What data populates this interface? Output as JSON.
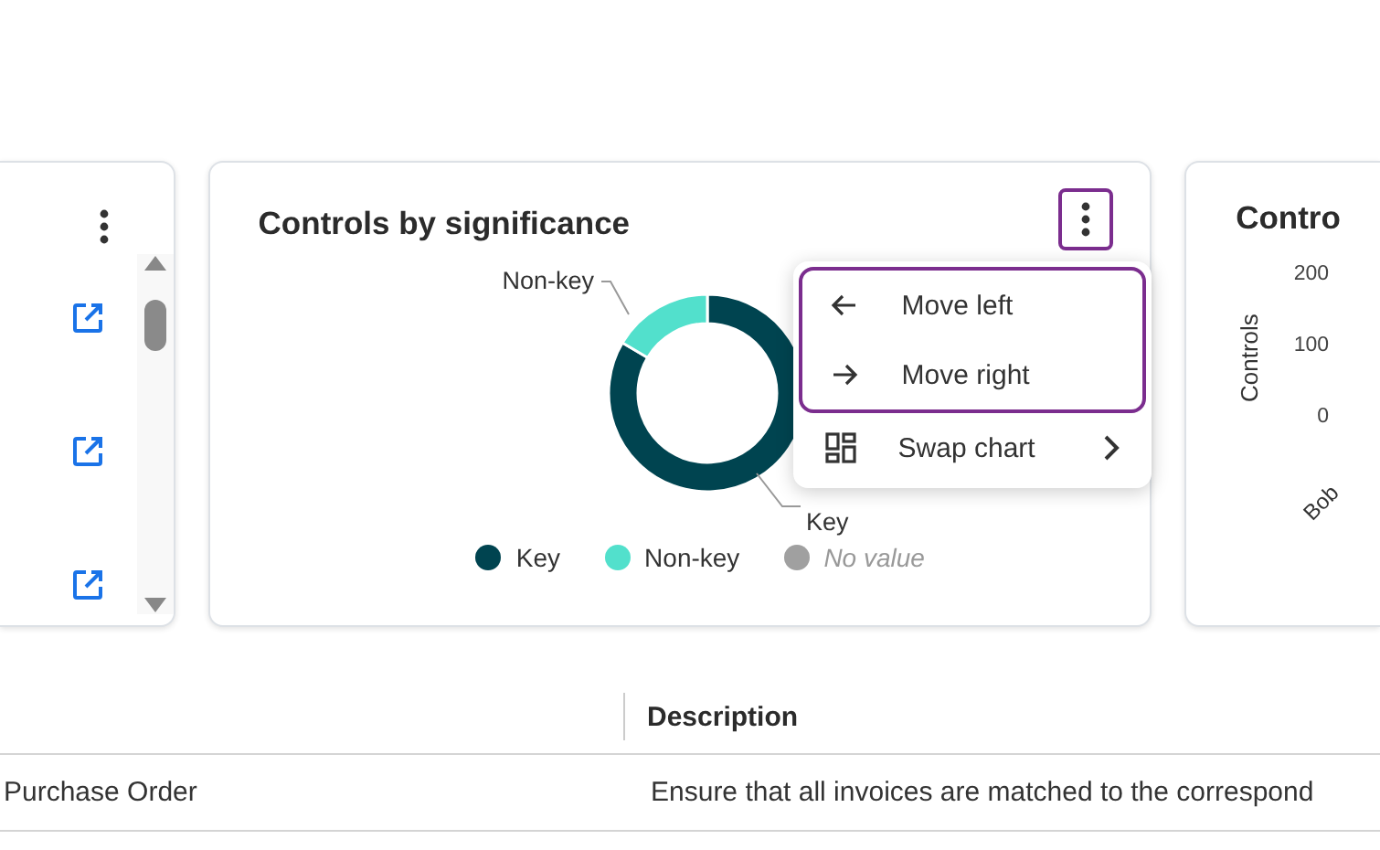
{
  "left_card": {
    "menu_focused": false,
    "links": [
      {
        "kind": "external"
      },
      {
        "kind": "external"
      },
      {
        "kind": "external"
      }
    ]
  },
  "significance_card": {
    "title": "Controls by significance",
    "menu_focused": true,
    "donut_labels": [
      {
        "label": "Non-key",
        "kind": "upper"
      },
      {
        "label": "Key",
        "kind": "lower"
      }
    ],
    "legend": [
      {
        "label": "Key",
        "color": "#004450",
        "kind": "value"
      },
      {
        "label": "Non-key",
        "color": "#52e0cc",
        "kind": "value"
      },
      {
        "label": "No value",
        "color": "#a0a0a0",
        "kind": "empty"
      }
    ],
    "menu": [
      {
        "label": "Move left",
        "kind": "left",
        "focused": true
      },
      {
        "label": "Move right",
        "kind": "right",
        "focused": true
      },
      {
        "label": "Swap chart",
        "kind": "swap",
        "focused": false
      }
    ]
  },
  "owner_card": {
    "title": "Contro",
    "y_label": "Controls",
    "y_ticks": [
      "200",
      "100",
      "0"
    ],
    "x_label": "Bob"
  },
  "table": {
    "columns": [
      {
        "kind": "blank"
      },
      {
        "kind": "text",
        "label": "Description"
      }
    ],
    "rows": [
      [
        "Purchase Order",
        "Ensure that all invoices are matched to the correspond"
      ]
    ]
  }
}
